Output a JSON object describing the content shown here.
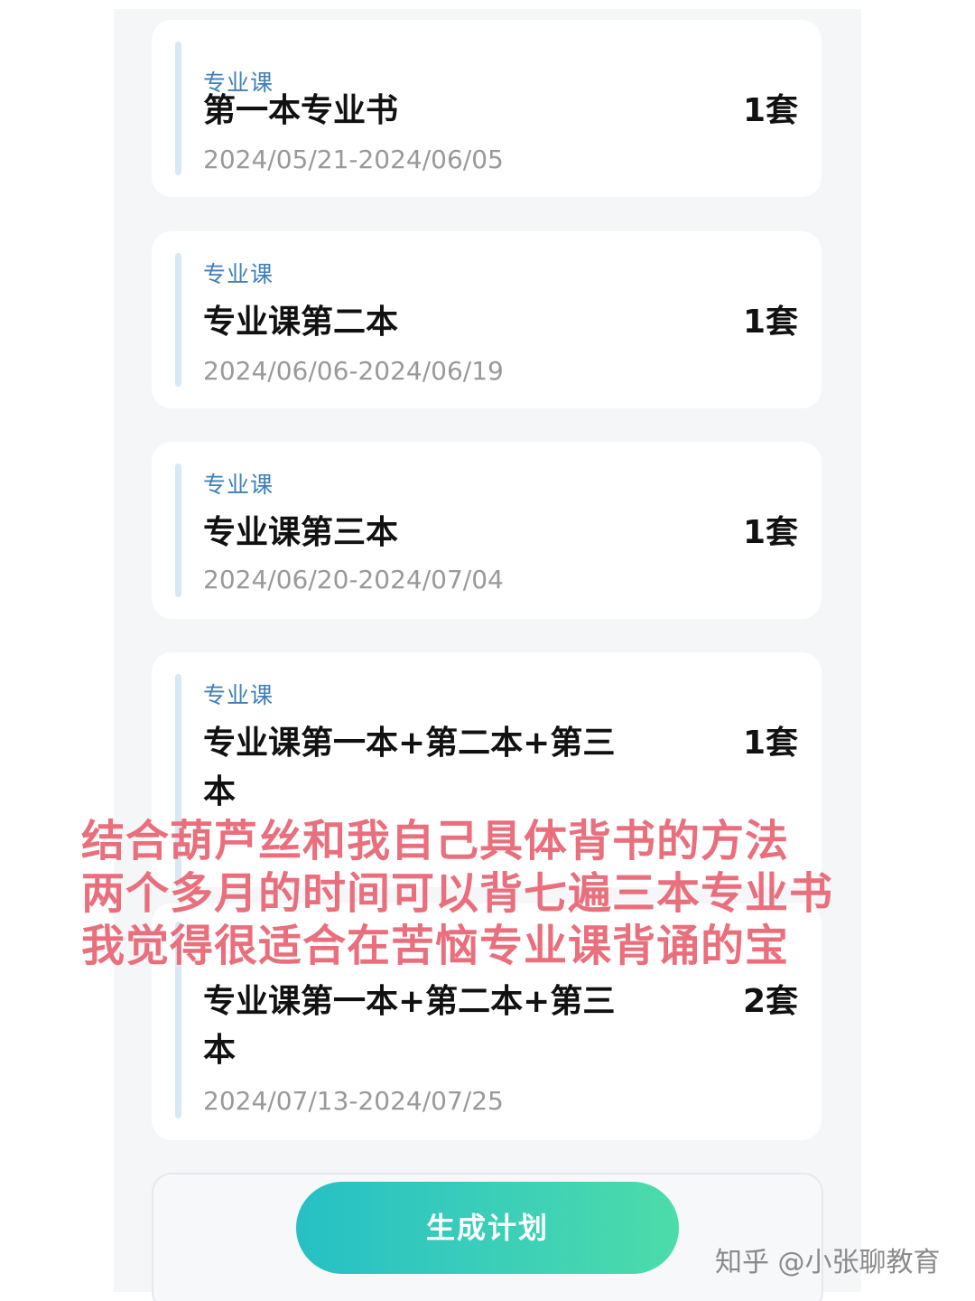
{
  "cards": [
    {
      "tag": "专业课",
      "title": "第一本专业书",
      "count": "1套",
      "date": "2024/05/21-2024/06/05"
    },
    {
      "tag": "专业课",
      "title": "专业课第二本",
      "count": "1套",
      "date": "2024/06/06-2024/06/19"
    },
    {
      "tag": "专业课",
      "title": "专业课第三本",
      "count": "1套",
      "date": "2024/06/20-2024/07/04"
    },
    {
      "tag": "专业课",
      "title": "专业课第一本+第二本+第三本",
      "count": "1套",
      "date": ""
    },
    {
      "tag": "",
      "title": "专业课第一本+第二本+第三本",
      "count": "2套",
      "date": "2024/07/13-2024/07/25"
    }
  ],
  "overlay": {
    "lines": [
      "结合葫芦丝和我自己具体背书的方法",
      "两个多月的时间可以背七遍三本专业书",
      "我觉得很适合在苦恼专业课背诵的宝"
    ]
  },
  "footer": {
    "generate_label": "生成计划"
  },
  "watermark": "知乎 @小张聊教育"
}
